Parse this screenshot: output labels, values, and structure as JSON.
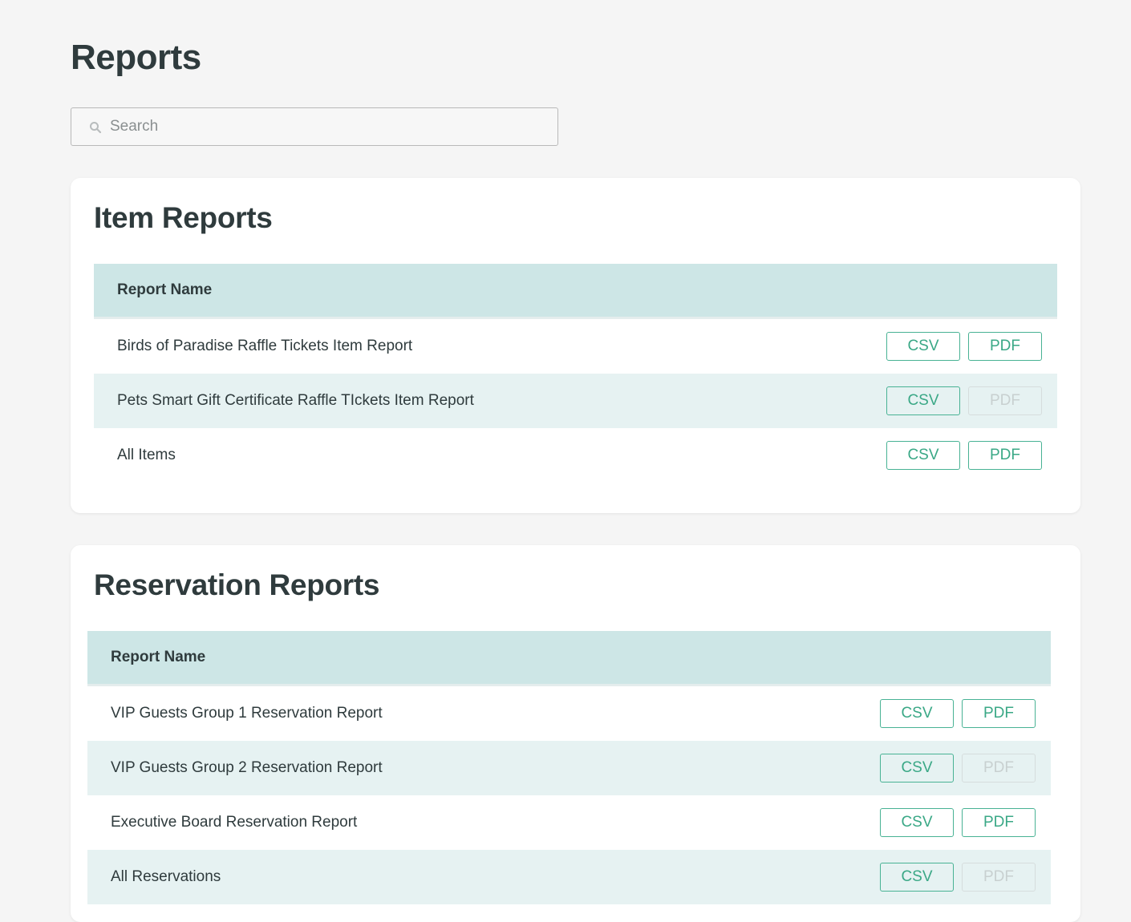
{
  "page": {
    "title": "Reports"
  },
  "search": {
    "placeholder": "Search",
    "value": ""
  },
  "sections": [
    {
      "title": "Item Reports",
      "column_header": "Report Name",
      "rows": [
        {
          "name": "Birds of Paradise Raffle Tickets Item Report",
          "csv_label": "CSV",
          "pdf_label": "PDF",
          "pdf_enabled": true
        },
        {
          "name": "Pets Smart Gift Certificate Raffle TIckets Item Report",
          "csv_label": "CSV",
          "pdf_label": "PDF",
          "pdf_enabled": false
        },
        {
          "name": "All Items",
          "csv_label": "CSV",
          "pdf_label": "PDF",
          "pdf_enabled": true
        }
      ]
    },
    {
      "title": "Reservation Reports",
      "column_header": "Report Name",
      "rows": [
        {
          "name": "VIP Guests Group 1 Reservation Report",
          "csv_label": "CSV",
          "pdf_label": "PDF",
          "pdf_enabled": true
        },
        {
          "name": "VIP Guests Group 2 Reservation Report",
          "csv_label": "CSV",
          "pdf_label": "PDF",
          "pdf_enabled": false
        },
        {
          "name": "Executive Board Reservation Report",
          "csv_label": "CSV",
          "pdf_label": "PDF",
          "pdf_enabled": true
        },
        {
          "name": "All Reservations",
          "csv_label": "CSV",
          "pdf_label": "PDF",
          "pdf_enabled": false
        }
      ]
    }
  ],
  "icons": {
    "search": "search-icon"
  },
  "colors": {
    "background": "#f5f5f5",
    "header_row": "#cde6e6",
    "alt_row": "#e6f2f2",
    "accent": "#48b294",
    "disabled": "#d6dddd",
    "text": "#2f3b3d"
  }
}
